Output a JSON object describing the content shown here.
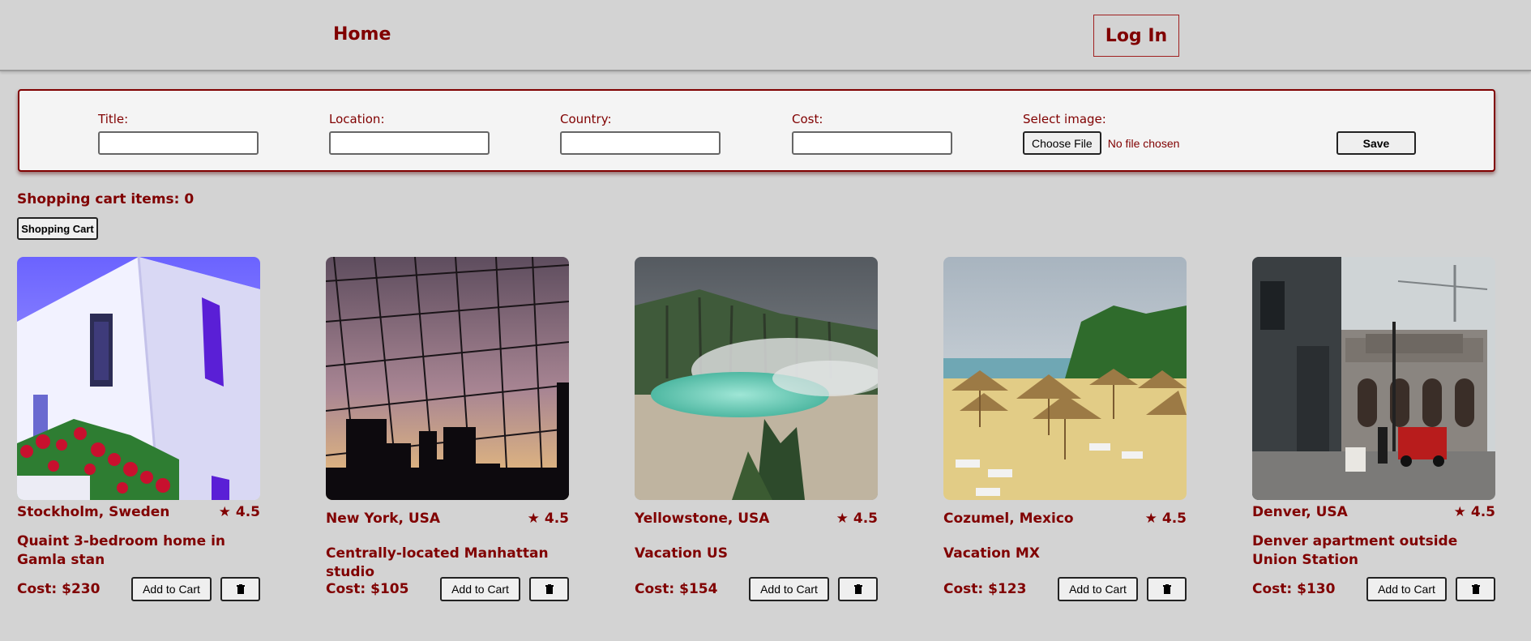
{
  "nav": {
    "home_label": "Home",
    "login_label": "Log In"
  },
  "form": {
    "title_label": "Title:",
    "location_label": "Location:",
    "country_label": "Country:",
    "cost_label": "Cost:",
    "image_label": "Select image:",
    "file_button_label": "Choose File",
    "file_status": "No file chosen",
    "save_label": "Save"
  },
  "cart": {
    "count_label": "Shopping cart items: 0",
    "button_label": "Shopping Cart"
  },
  "listings": [
    {
      "location": "Stockholm, Sweden",
      "rating": "4.5",
      "title": "Quaint 3-bedroom home in Gamla stan",
      "cost": "Cost: $230",
      "add_label": "Add to Cart",
      "image": "white-house-red-flowers"
    },
    {
      "location": "New York, USA",
      "rating": "4.5",
      "title": "Centrally-located Manhattan studio",
      "cost": "Cost: $105",
      "add_label": "Add to Cart",
      "image": "bridge-cables-skyline"
    },
    {
      "location": "Yellowstone, USA",
      "rating": "4.5",
      "title": "Vacation US",
      "cost": "Cost: $154",
      "add_label": "Add to Cart",
      "image": "hot-spring-steam"
    },
    {
      "location": "Cozumel, Mexico",
      "rating": "4.5",
      "title": "Vacation MX",
      "cost": "Cost: $123",
      "add_label": "Add to Cart",
      "image": "beach-umbrellas"
    },
    {
      "location": "Denver, USA",
      "rating": "4.5",
      "title": "Denver apartment outside Union Station",
      "cost": "Cost: $130",
      "add_label": "Add to Cart",
      "image": "union-station-street"
    }
  ],
  "icons": {
    "star": "star-icon",
    "delete": "trash-icon"
  },
  "colors": {
    "accent": "#800000",
    "background": "#d3d3d3",
    "panel": "#f4f4f4"
  }
}
